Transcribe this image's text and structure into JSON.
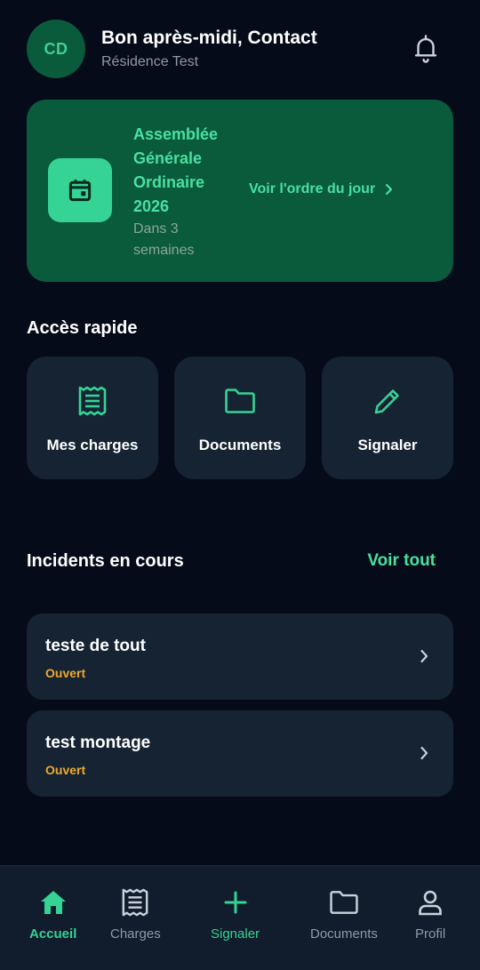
{
  "header": {
    "initials": "CD",
    "greeting": "Bon après-midi, Contact",
    "residence": "Résidence Test"
  },
  "event": {
    "title": "Assemblée Générale Ordinaire 2026",
    "subtitle": "Dans 3 semaines",
    "link_label": "Voir l'ordre du jour"
  },
  "quick_access": {
    "title": "Accès rapide",
    "items": [
      {
        "label": "Mes charges",
        "icon": "receipt-icon"
      },
      {
        "label": "Documents",
        "icon": "folder-icon"
      },
      {
        "label": "Signaler",
        "icon": "pencil-icon"
      }
    ]
  },
  "incidents": {
    "title": "Incidents en cours",
    "see_all": "Voir tout",
    "items": [
      {
        "title": "teste de tout",
        "status": "Ouvert"
      },
      {
        "title": "test montage",
        "status": "Ouvert"
      }
    ]
  },
  "nav": {
    "items": [
      {
        "label": "Accueil",
        "icon": "home-icon"
      },
      {
        "label": "Charges",
        "icon": "receipt-icon"
      },
      {
        "label": "Signaler",
        "icon": "plus-icon"
      },
      {
        "label": "Documents",
        "icon": "folder-icon"
      },
      {
        "label": "Profil",
        "icon": "person-icon"
      }
    ]
  },
  "colors": {
    "background": "#060b19",
    "card": "#152333",
    "accent": "#35d394",
    "event_card": "#0a5a3c",
    "status_open": "#f0a92c"
  }
}
